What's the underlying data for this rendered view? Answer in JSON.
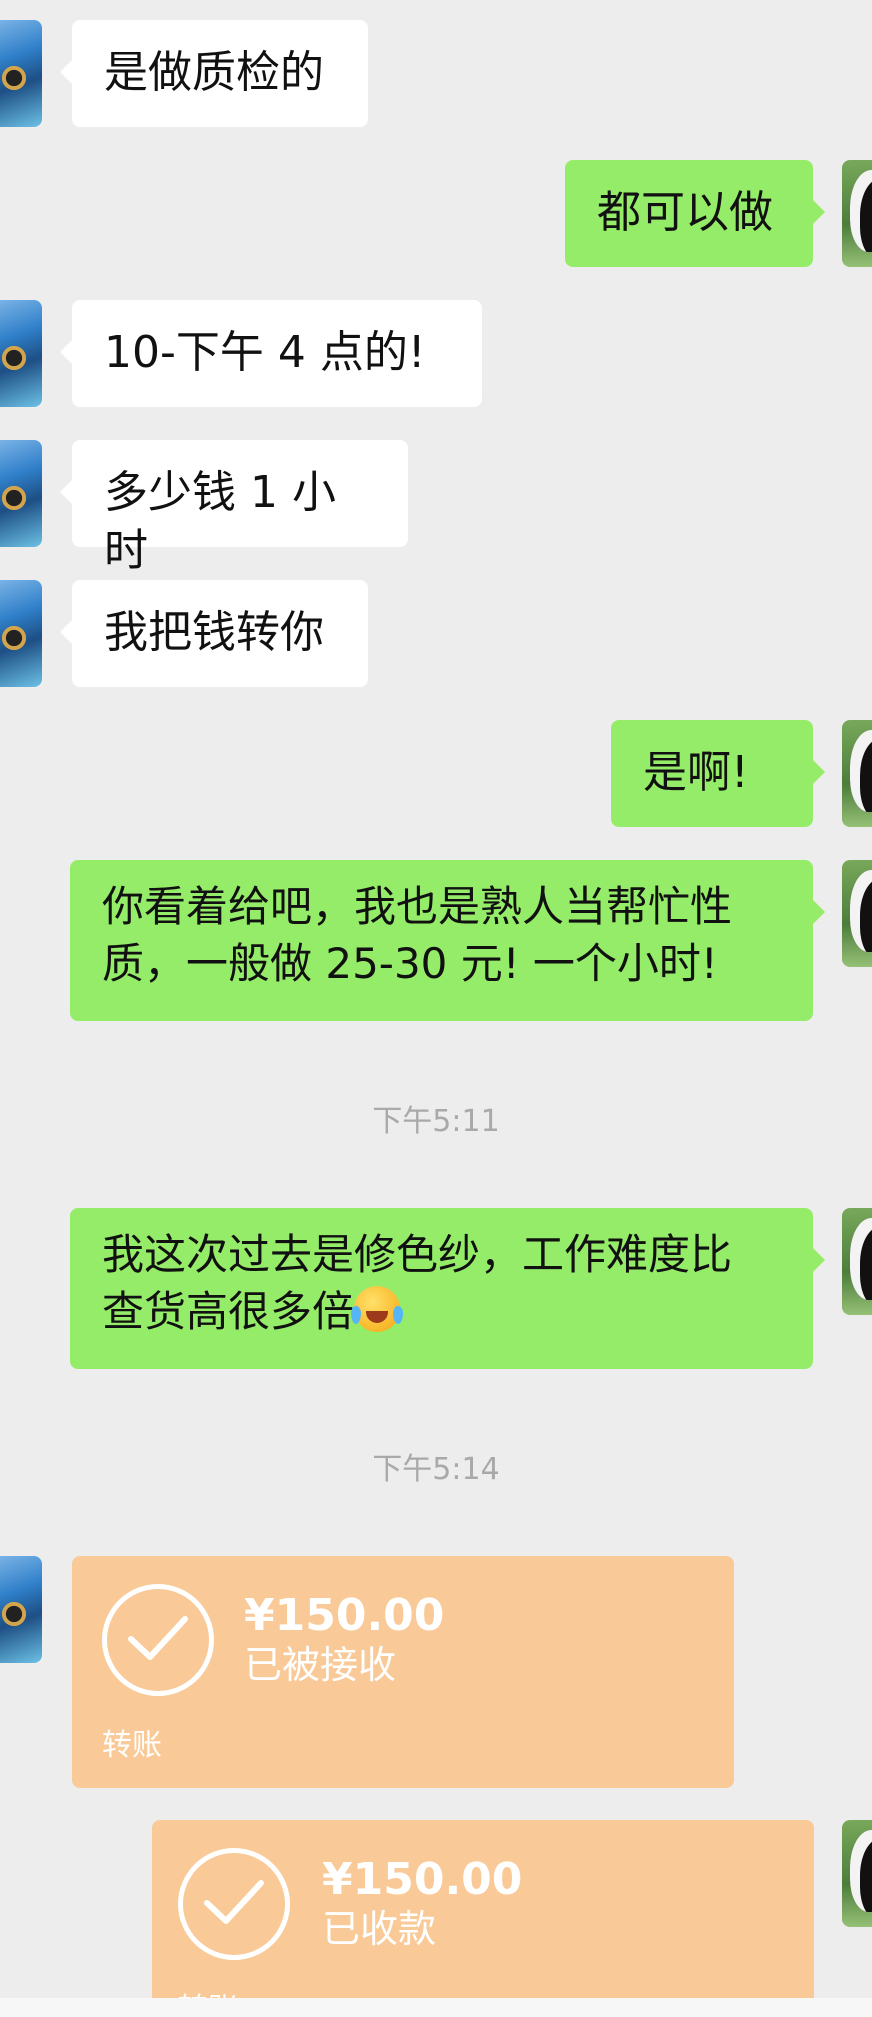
{
  "messages": [
    {
      "side": "left",
      "text": "是做质检的"
    },
    {
      "side": "right",
      "text": "都可以做"
    },
    {
      "side": "left",
      "text": "10-下午 4 点的!"
    },
    {
      "side": "left",
      "text": "多少钱 1 小时"
    },
    {
      "side": "left",
      "text": "我把钱转你"
    },
    {
      "side": "right",
      "text": "是啊!"
    },
    {
      "side": "right",
      "line1": "你看着给吧，我也是熟人当帮忙性",
      "line2": "质，一般做 25-30 元!  一个小时!"
    },
    {
      "side": "right",
      "line1": "我这次过去是修色纱，工作难度比",
      "line2": "查货高很多倍"
    }
  ],
  "timestamps": [
    "下午5:11",
    "下午5:14"
  ],
  "transfers": [
    {
      "side": "left",
      "amount": "¥150.00",
      "status": "已被接收",
      "label": "转账"
    },
    {
      "side": "right",
      "amount": "¥150.00",
      "status": "已收款",
      "label": "转账"
    }
  ],
  "icons": {
    "emoji": "face-with-tears-of-joy",
    "transfer_check": "check-circle-icon"
  },
  "colors": {
    "background": "#ededed",
    "incoming_bubble": "#ffffff",
    "outgoing_bubble": "#95ec69",
    "transfer_card": "#f9c997",
    "timestamp": "#a9a9a9"
  }
}
